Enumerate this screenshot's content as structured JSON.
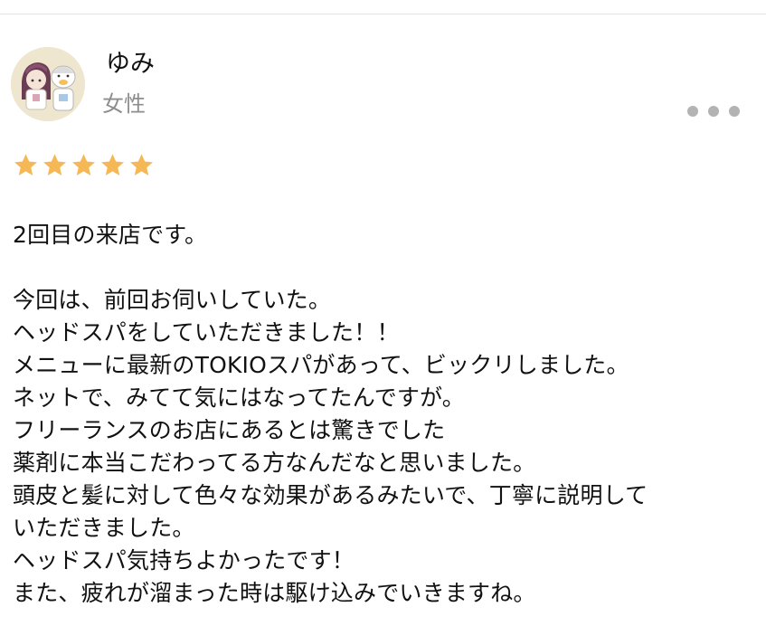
{
  "review": {
    "user": {
      "name": "ゆみ",
      "gender": "女性",
      "avatar": "avatar-illustration"
    },
    "rating": 5,
    "rating_max": 5,
    "star_color": "#f5b857",
    "more_icon": "ellipsis-icon",
    "body": {
      "line1": "2回目の来店です。",
      "line2": "",
      "line3": "今回は、前回お伺いしていた。",
      "line4": "ヘッドスパをしていただきました！！",
      "line5": "メニューに最新のTOKIOスパがあって、ビックリしました。",
      "line6": "ネットで、みてて気にはなってたんですが。",
      "line7": "フリーランスのお店にあるとは驚きでした",
      "line8": "薬剤に本当こだわってる方なんだなと思いました。",
      "line9": "頭皮と髪に対して色々な効果があるみたいで、丁寧に説明して",
      "line10": "いただきました。",
      "line11": "ヘッドスパ気持ちよかったです！",
      "line12": "また、疲れが溜まった時は駆け込みでいきますね。"
    }
  }
}
